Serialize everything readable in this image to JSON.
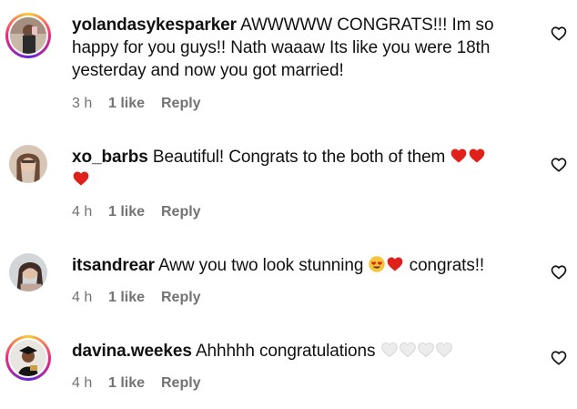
{
  "comments": [
    {
      "username": "yolandasykesparker",
      "text_lines": [
        "AWWWWW CONGRATS!!! Im so",
        "happy for you guys!! Nath waaaw Its like you were 18th",
        "yesterday and now you got married!"
      ],
      "time": "3 h",
      "likes": "1 like",
      "reply": "Reply"
    },
    {
      "username": "xo_barbs",
      "text": "Beautiful! Congrats to the both of them",
      "time": "4 h",
      "likes": "1 like",
      "reply": "Reply"
    },
    {
      "username": "itsandrear",
      "text_before": "Aww you two look stunning",
      "text_after": "congrats!!",
      "time": "4 h",
      "likes": "1 like",
      "reply": "Reply"
    },
    {
      "username": "davina.weekes",
      "text": "Ahhhhh congratulations",
      "time": "4 h",
      "likes": "1 like",
      "reply": "Reply"
    }
  ],
  "colors": {
    "meta": "#737373",
    "heart_emoji": "#e0201b",
    "white_heart": "#e6e6e6"
  },
  "icons": {
    "like_button": "heart-outline-icon"
  }
}
